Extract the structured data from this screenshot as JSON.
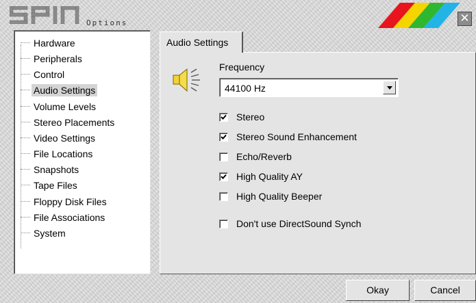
{
  "window": {
    "title": "Options",
    "close_symbol": "✕",
    "logo": "SPIN",
    "stripe_colors": [
      "#e8141e",
      "#f5d400",
      "#2fb82f",
      "#22b4e6"
    ]
  },
  "tree": {
    "items": [
      {
        "label": "Hardware",
        "selected": false
      },
      {
        "label": "Peripherals",
        "selected": false
      },
      {
        "label": "Control",
        "selected": false
      },
      {
        "label": "Audio Settings",
        "selected": true
      },
      {
        "label": "Volume Levels",
        "selected": false
      },
      {
        "label": "Stereo Placements",
        "selected": false
      },
      {
        "label": "Video Settings",
        "selected": false
      },
      {
        "label": "File Locations",
        "selected": false
      },
      {
        "label": "Snapshots",
        "selected": false
      },
      {
        "label": "Tape Files",
        "selected": false
      },
      {
        "label": "Floppy Disk Files",
        "selected": false
      },
      {
        "label": "File Associations",
        "selected": false
      },
      {
        "label": "System",
        "selected": false
      }
    ]
  },
  "tab": {
    "label": "Audio Settings"
  },
  "audio": {
    "icon": "speaker-icon",
    "frequency_label": "Frequency",
    "frequency_value": "44100 Hz",
    "options": [
      {
        "label": "Stereo",
        "checked": true
      },
      {
        "label": "Stereo Sound Enhancement",
        "checked": true
      },
      {
        "label": "Echo/Reverb",
        "checked": false
      },
      {
        "label": "High Quality AY",
        "checked": true
      },
      {
        "label": "High Quality Beeper",
        "checked": false
      },
      {
        "label": "Don't use DirectSound Synch",
        "checked": false
      }
    ]
  },
  "buttons": {
    "okay": "Okay",
    "cancel": "Cancel"
  }
}
